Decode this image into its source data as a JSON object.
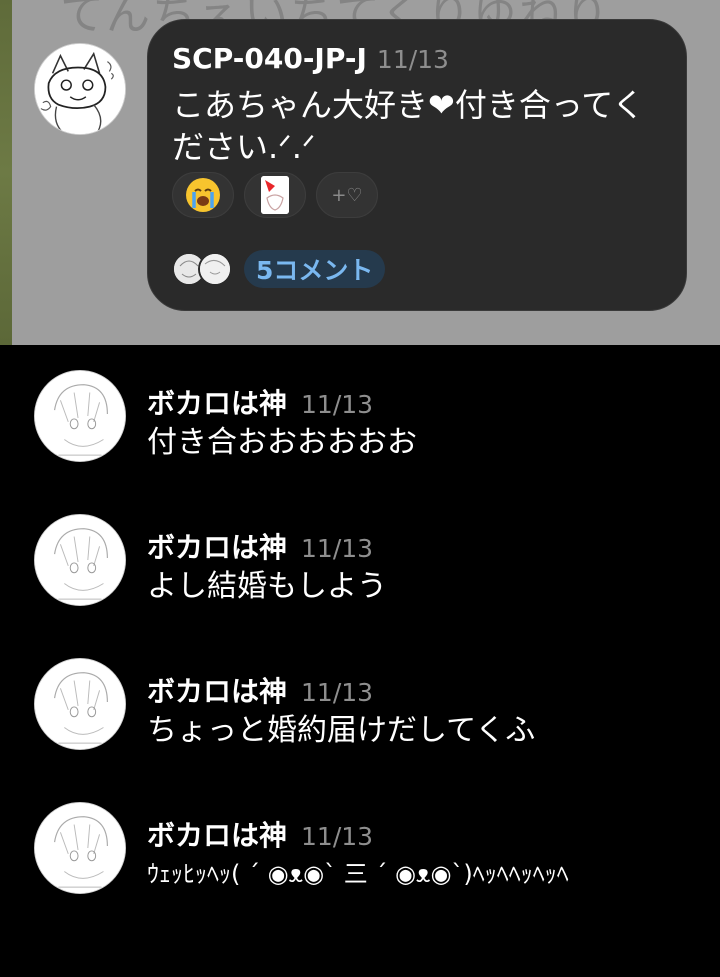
{
  "background": {
    "faint_text": "てんちえいちてくりゆねり",
    "wallpaper_color": "#9e9e9e"
  },
  "post": {
    "author": "SCP-040-JP-J",
    "date": "11/13",
    "body": "こあちゃん大好き❤付き合ってください.ᐟ.ᐟ",
    "reactions": [
      {
        "icon": "crying-face-emoji",
        "label": ""
      },
      {
        "icon": "sticker-icon",
        "label": ""
      },
      {
        "icon": "add-reaction-heart-icon",
        "label": "+♡"
      }
    ],
    "comment_count": "5コメント",
    "bubble_color": "#2a2a2a",
    "accent_color": "#7ab8f0"
  },
  "comments": [
    {
      "author": "ボカロは神",
      "date": "11/13",
      "text": "付き合おおおおおお"
    },
    {
      "author": "ボカロは神",
      "date": "11/13",
      "text": "よし結婚もしよう"
    },
    {
      "author": "ボカロは神",
      "date": "11/13",
      "text": "ちょっと婚約届けだしてくふ"
    },
    {
      "author": "ボカロは神",
      "date": "11/13",
      "text": "ｳｪｯﾋｯﾍｯ( ´ ◉ᴥ◉` 三 ´ ◉ᴥ◉`)ﾍｯﾍﾍｯﾍｯﾍ"
    }
  ]
}
